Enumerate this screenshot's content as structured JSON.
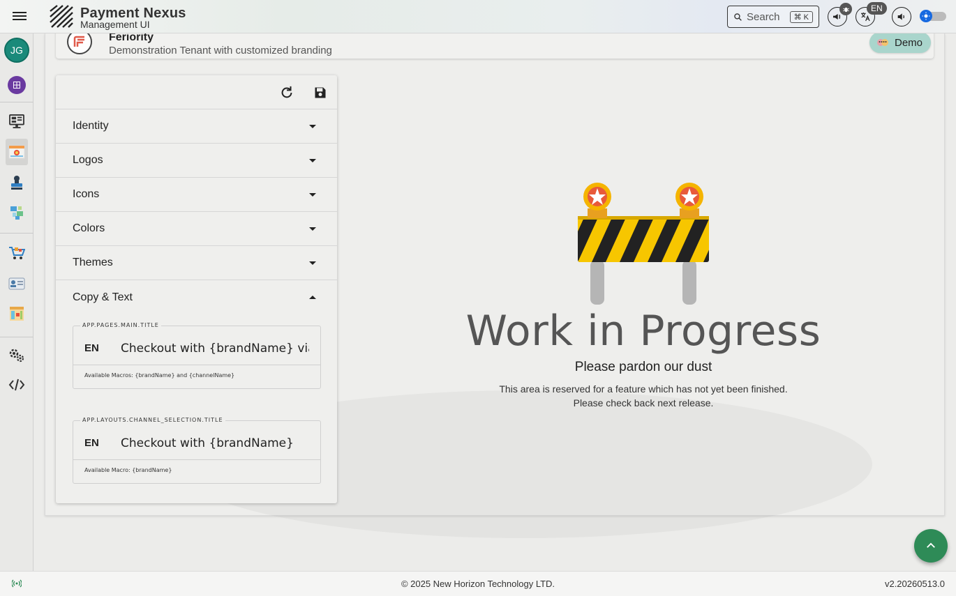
{
  "header": {
    "brand_title": "Payment Nexus",
    "brand_subtitle": "Management UI",
    "search_placeholder": "Search",
    "search_shortcut": "⌘ K",
    "language_badge": "EN"
  },
  "sidebar": {
    "avatar_initials": "JG",
    "items": [
      {
        "name": "dashboard-monitor-icon"
      },
      {
        "name": "branding-icon",
        "active": true
      },
      {
        "name": "stamp-icon"
      },
      {
        "name": "integrations-icon"
      },
      {
        "name": "shopping-cart-icon"
      },
      {
        "name": "id-card-icon"
      },
      {
        "name": "reports-icon"
      },
      {
        "name": "settings-gears-icon"
      },
      {
        "name": "code-icon"
      }
    ]
  },
  "tenant": {
    "name": "Feriority",
    "description": "Demonstration Tenant with customized branding",
    "chip_label": "Demo"
  },
  "settings_panel": {
    "sections": [
      {
        "label": "Identity",
        "expanded": false
      },
      {
        "label": "Logos",
        "expanded": false
      },
      {
        "label": "Icons",
        "expanded": false
      },
      {
        "label": "Colors",
        "expanded": false
      },
      {
        "label": "Themes",
        "expanded": false
      },
      {
        "label": "Copy & Text",
        "expanded": true
      }
    ],
    "fields": [
      {
        "legend": "APP.PAGES.MAIN.TITLE",
        "lang": "EN",
        "value": "Checkout with {brandName} via {channelName}",
        "hint": "Available Macros: {brandName} and {channelName}"
      },
      {
        "legend": "APP.LAYOUTS.CHANNEL_SELECTION.TITLE",
        "lang": "EN",
        "value": "Checkout with {brandName}",
        "hint": "Available Macro: {brandName}"
      }
    ]
  },
  "wip": {
    "title": "Work in Progress",
    "subtitle": "Please pardon our dust",
    "line1": "This area is reserved for a feature which has not yet been finished.",
    "line2": "Please check back next release."
  },
  "footer": {
    "copyright": "© 2025 New Horizon Technology LTD.",
    "version": "v2.20260513.0"
  },
  "colors": {
    "accent_green": "#2e8b57",
    "avatar_teal": "#1a8a7a",
    "demo_chip": "#a9d5cc",
    "toggle_blue": "#1769e0"
  }
}
